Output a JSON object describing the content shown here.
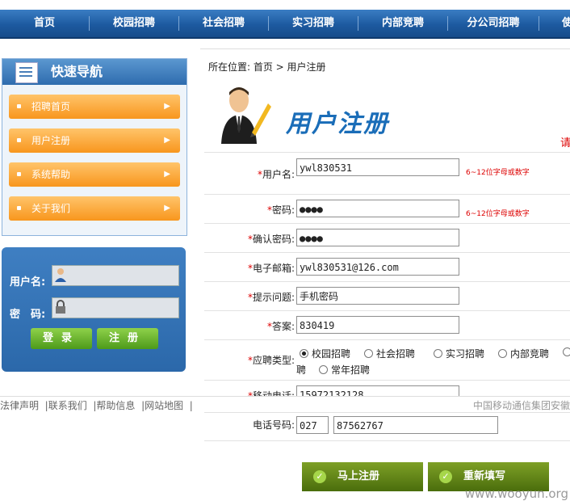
{
  "nav": {
    "items": [
      "首页",
      "校园招聘",
      "社会招聘",
      "实习招聘",
      "内部竞聘",
      "分公司招聘",
      "使"
    ]
  },
  "quick_nav": {
    "title": "快速导航",
    "items": [
      "招聘首页",
      "用户注册",
      "系统帮助",
      "关于我们"
    ]
  },
  "login": {
    "username_label": "用户名:",
    "password_label": "密　码:",
    "login_button": "登录",
    "register_button": "注册"
  },
  "breadcrumb": "所在位置: 首页 > 用户注册",
  "page_title": "用户注册",
  "page_hint": "请",
  "form": {
    "username": {
      "label": "用户名:",
      "value": "ywl830531",
      "tip": "6~12位字母或数字"
    },
    "password": {
      "label": "密码:",
      "value": "●●●●",
      "tip": "6~12位字母或数字"
    },
    "confirm": {
      "label": "确认密码:",
      "value": "●●●●"
    },
    "email": {
      "label": "电子邮箱:",
      "value": "ywl830531@126.com"
    },
    "question": {
      "label": "提示问题:",
      "value": "手机密码"
    },
    "answer": {
      "label": "答案:",
      "value": "830419"
    },
    "type": {
      "label": "应聘类型:",
      "options": [
        "校园招聘",
        "社会招聘",
        "实习招聘",
        "内部竞聘",
        "聘",
        "常年招聘"
      ],
      "selected": "校园招聘"
    },
    "mobile": {
      "label": "移动电话:",
      "value": "15972132128"
    },
    "phone": {
      "label": "电话号码:",
      "area": "027",
      "value": "87562767"
    }
  },
  "footer": {
    "links": [
      "法律声明",
      "联系我们",
      "帮助信息",
      "网站地图"
    ],
    "right": "中国移动通信集团安徽"
  },
  "buttons": {
    "submit": "马上注册",
    "reset": "重新填写"
  },
  "watermark": "www.wooyun.org",
  "colors": {
    "nav": "#1d5aa0",
    "accent": "#f8961d",
    "green": "#4d9a1a",
    "required": "#dd0000"
  }
}
